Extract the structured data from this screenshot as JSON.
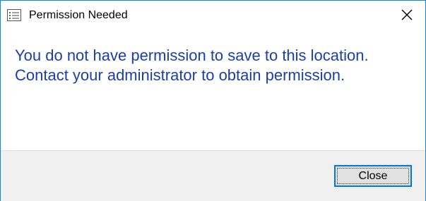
{
  "window": {
    "title": "Permission Needed",
    "app_icon": "list-window-icon",
    "close_icon": "close-icon"
  },
  "message": {
    "text": "You do not have permission to save to this location. Contact your administrator to obtain permission."
  },
  "buttons": {
    "close_label": "Close"
  },
  "colors": {
    "border": "#1883d7",
    "message_text": "#1a3fa6",
    "footer_bg": "#f0f0f0",
    "button_focus_border": "#0078d7"
  }
}
